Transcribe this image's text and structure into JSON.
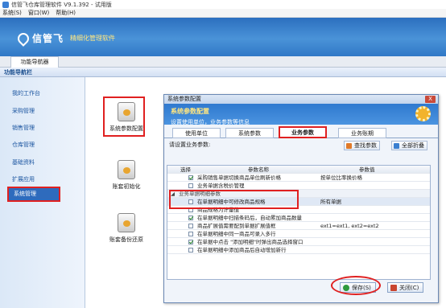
{
  "app": {
    "title": "信管飞仓库管理软件 V9.1.392 - 试用版"
  },
  "menu": [
    "系统(S)",
    "窗口(W)",
    "帮助(H)"
  ],
  "banner": {
    "brand": "信管飞",
    "tagline": "精细化管理软件"
  },
  "tabs": {
    "nav": "功能导航器"
  },
  "nav": {
    "header": "功能导航栏"
  },
  "sidebar": {
    "items": [
      "我的工作台",
      "采购管理",
      "销售管理",
      "仓库管理",
      "基础资料",
      "扩展应用",
      "系统管理"
    ]
  },
  "tiles": [
    "系统参数配置",
    "账套初始化",
    "账套备份还原"
  ],
  "dialog": {
    "title": "系统参数配置",
    "close": "X",
    "header_title": "系统参数配置",
    "header_sub": "设置使用单位，业务参数等信息",
    "tabs": [
      "使用单位",
      "系统参数",
      "业务参数",
      "业务账期"
    ],
    "prompt": "请设置业务参数:",
    "find_button": "查找参数",
    "fold_button": "全部折叠",
    "grid": {
      "columns": [
        "选择",
        "参数名称",
        "参数值"
      ],
      "rows": [
        {
          "checked": true,
          "name": "采购销售单据切换商品单位刷新价格",
          "value": "按单位比率换价格"
        },
        {
          "checked": false,
          "name": "业务单据含税价管理",
          "value": ""
        },
        {
          "group": true,
          "name": "业务单据明细参数"
        },
        {
          "checked": false,
          "name": "在单据明细中可修改商品规格",
          "value": "所有单据"
        },
        {
          "checked": false,
          "name": "商品规格为计量值",
          "value": ""
        },
        {
          "checked": true,
          "name": "在单据明细中扫描条码后，自动累加商品数量",
          "value": ""
        },
        {
          "checked": false,
          "name": "商品扩展值需要配到单据扩展值框",
          "value": "ext1=ext1, ext2=ext2"
        },
        {
          "checked": false,
          "name": "在单据明细中同一商品可录入多行",
          "value": ""
        },
        {
          "checked": true,
          "name": "在单据中点击 \"添加明细\"时弹出商品选择窗口",
          "value": ""
        },
        {
          "checked": false,
          "name": "在单据明细中添加商品后自动增加新行",
          "value": ""
        }
      ]
    },
    "save": "保存(S)",
    "close_button": "关闭(C)"
  }
}
